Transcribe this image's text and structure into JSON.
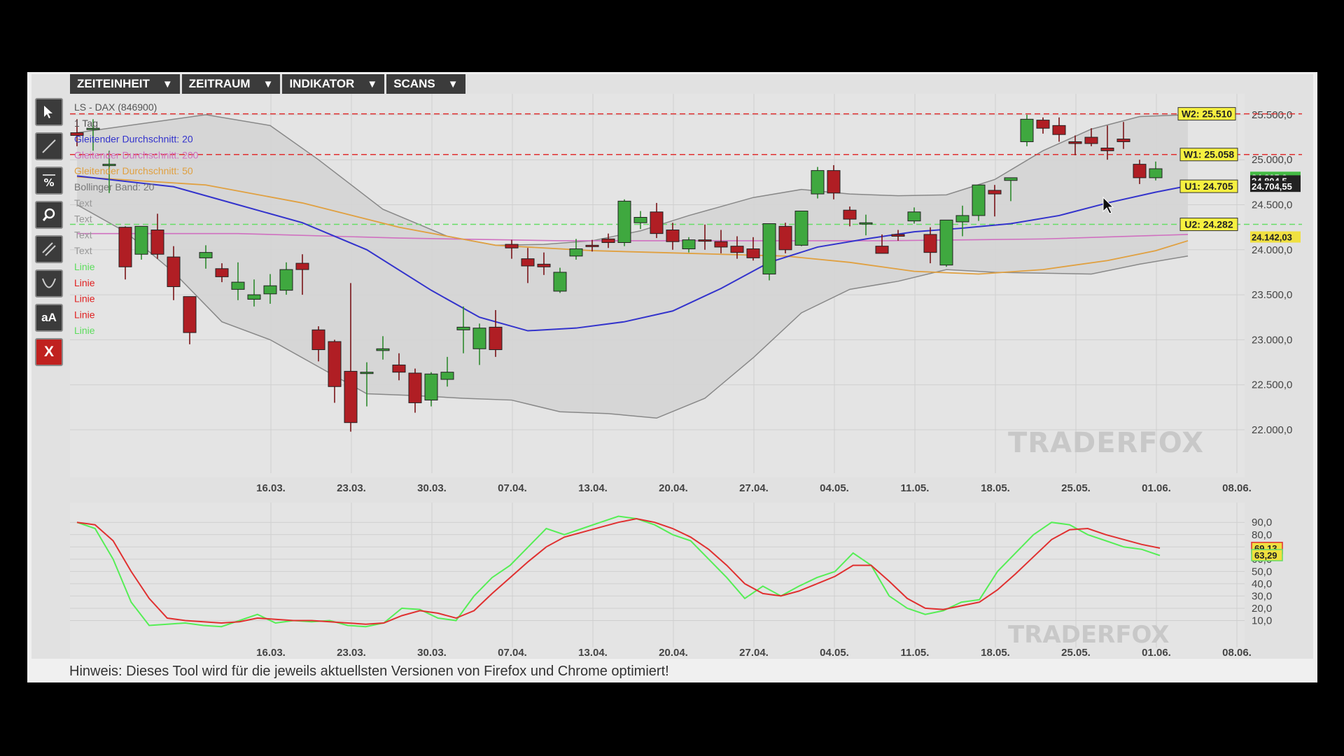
{
  "menu": [
    {
      "label": "ZEITEINHEIT"
    },
    {
      "label": "ZEITRAUM"
    },
    {
      "label": "INDIKATOR"
    },
    {
      "label": "SCANS"
    }
  ],
  "toolbar": [
    {
      "name": "select-tool",
      "icon": "cursor-icon"
    },
    {
      "name": "line-tool",
      "icon": "line-icon"
    },
    {
      "name": "percent-tool",
      "icon": "percent-icon"
    },
    {
      "name": "zoom-tool",
      "icon": "magnifier-icon"
    },
    {
      "name": "channel-tool",
      "icon": "parallel-lines-icon"
    },
    {
      "name": "arc-tool",
      "icon": "arc-icon"
    },
    {
      "name": "text-tool",
      "icon": "text-size-icon",
      "label": "aA"
    },
    {
      "name": "delete-tool",
      "icon": "close-icon",
      "label": "X"
    }
  ],
  "legend": [
    {
      "text": "LS - DAX (846900)",
      "color": "#555555"
    },
    {
      "text": "1 Tag",
      "color": "#555555"
    },
    {
      "text": "Gleitender Durchschnitt: 20",
      "color": "#3333cc"
    },
    {
      "text": "Gleitender Durchschnitt: 200",
      "color": "#d070c0"
    },
    {
      "text": "Gleitender Durchschnitt: 50",
      "color": "#e0a040"
    },
    {
      "text": "Bollinger Band: 20",
      "color": "#777777"
    },
    {
      "text": "Text",
      "color": "#999999"
    },
    {
      "text": "Text",
      "color": "#999999"
    },
    {
      "text": "Text",
      "color": "#999999"
    },
    {
      "text": "Text",
      "color": "#999999"
    },
    {
      "text": "Linie",
      "color": "#5cdd5c"
    },
    {
      "text": "Linie",
      "color": "#e02020"
    },
    {
      "text": "Linie",
      "color": "#e02020"
    },
    {
      "text": "Linie",
      "color": "#e02020"
    },
    {
      "text": "Linie",
      "color": "#5cdd5c"
    }
  ],
  "levels": [
    {
      "label": "W2: 25.510",
      "value": 25510,
      "color": "#e03030",
      "style": "dashed"
    },
    {
      "label": "W1: 25.058",
      "value": 25058,
      "color": "#e03030",
      "style": "dashed"
    },
    {
      "label": "U1: 24.705",
      "value": 24705,
      "color": "#e03030",
      "style": "none"
    },
    {
      "label": "U2: 24.282",
      "value": 24282,
      "color": "#66dd66",
      "style": "dashed"
    }
  ],
  "price_tags": [
    {
      "text": "24.805,0",
      "value": 24805,
      "bg": "#44bb44",
      "fg": "#ffffff"
    },
    {
      "text": "24.804,5",
      "value": 24765,
      "bg": "#222222",
      "fg": "#ffffff"
    },
    {
      "text": "24.704,55",
      "value": 24704.55,
      "bg": "#222222",
      "fg": "#ffffff"
    },
    {
      "text": "24.142,03",
      "value": 24142.03,
      "bg": "#f0e040",
      "fg": "#222222"
    }
  ],
  "osc_tags": [
    {
      "text": "69,13",
      "value": 69.13,
      "bg": "#f0e040",
      "fg": "#222222",
      "border": "#e03030"
    },
    {
      "text": "63,29",
      "value": 63.29,
      "bg": "#f0e040",
      "fg": "#222222",
      "border": "#66dd66"
    }
  ],
  "watermark": "TRADERFOX",
  "hint": "Hinweis: Dieses Tool wird für die jeweils aktuellsten Versionen von Firefox und Chrome optimiert!",
  "colors": {
    "up": "#3fa83f",
    "down": "#b01e24",
    "ma20": "#3333cc",
    "ma200": "#d070c0",
    "ma50": "#e0a040",
    "boll": "#888888",
    "stochK": "#55ee55",
    "stochD": "#e03030"
  },
  "chart_data": [
    {
      "type": "candlestick",
      "title": "LS - DAX (846900)",
      "x_ticks": [
        "16.03.",
        "23.03.",
        "30.03.",
        "07.04.",
        "13.04.",
        "20.04.",
        "27.04.",
        "04.05.",
        "11.05.",
        "18.05.",
        "25.05.",
        "01.06.",
        "08.06."
      ],
      "y_ticks": [
        {
          "label": "25.500,0",
          "value": 25500
        },
        {
          "label": "25.000,0",
          "value": 25000
        },
        {
          "label": "24.500,0",
          "value": 24500
        },
        {
          "label": "24.000,0",
          "value": 24000
        },
        {
          "label": "23.500,0",
          "value": 23500
        },
        {
          "label": "23.000,0",
          "value": 23000
        },
        {
          "label": "22.500,0",
          "value": 22500
        },
        {
          "label": "22.000,0",
          "value": 22000
        }
      ],
      "candles": [
        {
          "o": 25300,
          "h": 25450,
          "l": 25150,
          "c": 25270
        },
        {
          "o": 25350,
          "h": 25450,
          "l": 25100,
          "c": 25350
        },
        {
          "o": 24950,
          "h": 25100,
          "l": 24630,
          "c": 24950
        },
        {
          "o": 24250,
          "h": 24260,
          "l": 23670,
          "c": 23810
        },
        {
          "o": 23950,
          "h": 24260,
          "l": 23890,
          "c": 24260
        },
        {
          "o": 24220,
          "h": 24400,
          "l": 23900,
          "c": 23950
        },
        {
          "o": 23920,
          "h": 24040,
          "l": 23440,
          "c": 23590
        },
        {
          "o": 23480,
          "h": 23480,
          "l": 22950,
          "c": 23080
        },
        {
          "o": 23910,
          "h": 24050,
          "l": 23790,
          "c": 23970
        },
        {
          "o": 23790,
          "h": 23850,
          "l": 23640,
          "c": 23700
        },
        {
          "o": 23560,
          "h": 23860,
          "l": 23440,
          "c": 23640
        },
        {
          "o": 23450,
          "h": 23670,
          "l": 23370,
          "c": 23500
        },
        {
          "o": 23510,
          "h": 23730,
          "l": 23400,
          "c": 23600
        },
        {
          "o": 23550,
          "h": 23860,
          "l": 23500,
          "c": 23780
        },
        {
          "o": 23850,
          "h": 23950,
          "l": 23500,
          "c": 23780
        },
        {
          "o": 23110,
          "h": 23150,
          "l": 22760,
          "c": 22890
        },
        {
          "o": 22980,
          "h": 23000,
          "l": 22300,
          "c": 22480
        },
        {
          "o": 22650,
          "h": 23630,
          "l": 21980,
          "c": 22080
        },
        {
          "o": 22640,
          "h": 22750,
          "l": 22260,
          "c": 22640
        },
        {
          "o": 22880,
          "h": 23040,
          "l": 22780,
          "c": 22900
        },
        {
          "o": 22720,
          "h": 22850,
          "l": 22550,
          "c": 22640
        },
        {
          "o": 22630,
          "h": 22680,
          "l": 22190,
          "c": 22300
        },
        {
          "o": 22330,
          "h": 22640,
          "l": 22260,
          "c": 22620
        },
        {
          "o": 22560,
          "h": 22810,
          "l": 22480,
          "c": 22640
        },
        {
          "o": 23110,
          "h": 23370,
          "l": 22850,
          "c": 23140
        },
        {
          "o": 22900,
          "h": 23180,
          "l": 22720,
          "c": 23130
        },
        {
          "o": 23140,
          "h": 23330,
          "l": 22810,
          "c": 22890
        },
        {
          "o": 24060,
          "h": 24110,
          "l": 23900,
          "c": 24020
        },
        {
          "o": 23900,
          "h": 24020,
          "l": 23630,
          "c": 23820
        },
        {
          "o": 23840,
          "h": 23970,
          "l": 23720,
          "c": 23810
        },
        {
          "o": 23540,
          "h": 23800,
          "l": 23520,
          "c": 23750
        },
        {
          "o": 23930,
          "h": 24120,
          "l": 23890,
          "c": 24010
        },
        {
          "o": 24050,
          "h": 24110,
          "l": 23980,
          "c": 24040
        },
        {
          "o": 24120,
          "h": 24180,
          "l": 24020,
          "c": 24080
        },
        {
          "o": 24080,
          "h": 24560,
          "l": 24040,
          "c": 24540
        },
        {
          "o": 24300,
          "h": 24430,
          "l": 24230,
          "c": 24360
        },
        {
          "o": 24420,
          "h": 24520,
          "l": 24130,
          "c": 24180
        },
        {
          "o": 24220,
          "h": 24300,
          "l": 24000,
          "c": 24090
        },
        {
          "o": 24010,
          "h": 24140,
          "l": 23970,
          "c": 24110
        },
        {
          "o": 24110,
          "h": 24280,
          "l": 24000,
          "c": 24100
        },
        {
          "o": 24090,
          "h": 24220,
          "l": 23960,
          "c": 24030
        },
        {
          "o": 24040,
          "h": 24150,
          "l": 23900,
          "c": 23970
        },
        {
          "o": 24010,
          "h": 24140,
          "l": 23880,
          "c": 23910
        },
        {
          "o": 23730,
          "h": 24290,
          "l": 23660,
          "c": 24290
        },
        {
          "o": 24260,
          "h": 24300,
          "l": 23960,
          "c": 24000
        },
        {
          "o": 24050,
          "h": 24430,
          "l": 24040,
          "c": 24430
        },
        {
          "o": 24620,
          "h": 24920,
          "l": 24570,
          "c": 24880
        },
        {
          "o": 24880,
          "h": 24940,
          "l": 24560,
          "c": 24630
        },
        {
          "o": 24440,
          "h": 24480,
          "l": 24260,
          "c": 24340
        },
        {
          "o": 24300,
          "h": 24390,
          "l": 24160,
          "c": 24300
        },
        {
          "o": 24040,
          "h": 24170,
          "l": 23980,
          "c": 23960
        },
        {
          "o": 24170,
          "h": 24220,
          "l": 24100,
          "c": 24150
        },
        {
          "o": 24320,
          "h": 24470,
          "l": 24290,
          "c": 24420
        },
        {
          "o": 24170,
          "h": 24250,
          "l": 23850,
          "c": 23970
        },
        {
          "o": 23830,
          "h": 24330,
          "l": 23810,
          "c": 24330
        },
        {
          "o": 24310,
          "h": 24490,
          "l": 24150,
          "c": 24380
        },
        {
          "o": 24380,
          "h": 24660,
          "l": 24320,
          "c": 24720
        },
        {
          "o": 24660,
          "h": 24720,
          "l": 24370,
          "c": 24620
        },
        {
          "o": 24770,
          "h": 24800,
          "l": 24540,
          "c": 24800
        },
        {
          "o": 25200,
          "h": 25500,
          "l": 25150,
          "c": 25450
        },
        {
          "o": 25440,
          "h": 25470,
          "l": 25290,
          "c": 25350
        },
        {
          "o": 25380,
          "h": 25470,
          "l": 25200,
          "c": 25280
        },
        {
          "o": 25200,
          "h": 25270,
          "l": 25050,
          "c": 25180
        },
        {
          "o": 25250,
          "h": 25350,
          "l": 25150,
          "c": 25180
        },
        {
          "o": 25130,
          "h": 25380,
          "l": 25000,
          "c": 25100
        },
        {
          "o": 25230,
          "h": 25420,
          "l": 25120,
          "c": 25200
        },
        {
          "o": 24950,
          "h": 25000,
          "l": 24730,
          "c": 24800
        },
        {
          "o": 24800,
          "h": 24980,
          "l": 24770,
          "c": 24900
        }
      ],
      "ma20": [
        [
          0,
          24820
        ],
        [
          6,
          24700
        ],
        [
          10,
          24500
        ],
        [
          14,
          24300
        ],
        [
          18,
          24000
        ],
        [
          22,
          23550
        ],
        [
          25,
          23250
        ],
        [
          28,
          23100
        ],
        [
          31,
          23130
        ],
        [
          34,
          23200
        ],
        [
          37,
          23320
        ],
        [
          40,
          23570
        ],
        [
          43,
          23860
        ],
        [
          46,
          24030
        ],
        [
          49,
          24120
        ],
        [
          52,
          24200
        ],
        [
          55,
          24240
        ],
        [
          58,
          24290
        ],
        [
          61,
          24380
        ],
        [
          64,
          24520
        ],
        [
          67,
          24640
        ],
        [
          69,
          24710
        ]
      ],
      "ma200": [
        [
          0,
          24180
        ],
        [
          10,
          24180
        ],
        [
          20,
          24130
        ],
        [
          30,
          24100
        ],
        [
          40,
          24100
        ],
        [
          50,
          24100
        ],
        [
          60,
          24120
        ],
        [
          69,
          24170
        ]
      ],
      "ma50": [
        [
          0,
          24810
        ],
        [
          8,
          24720
        ],
        [
          14,
          24520
        ],
        [
          20,
          24250
        ],
        [
          26,
          24050
        ],
        [
          32,
          23990
        ],
        [
          38,
          23960
        ],
        [
          44,
          23930
        ],
        [
          48,
          23860
        ],
        [
          52,
          23760
        ],
        [
          56,
          23730
        ],
        [
          60,
          23780
        ],
        [
          64,
          23880
        ],
        [
          67,
          23990
        ],
        [
          69,
          24100
        ]
      ],
      "boll_upper": [
        [
          0,
          25300
        ],
        [
          4,
          25400
        ],
        [
          8,
          25500
        ],
        [
          12,
          25380
        ],
        [
          15,
          25000
        ],
        [
          19,
          24450
        ],
        [
          23,
          24150
        ],
        [
          26,
          24050
        ],
        [
          29,
          24060
        ],
        [
          32,
          24100
        ],
        [
          35,
          24210
        ],
        [
          38,
          24380
        ],
        [
          42,
          24580
        ],
        [
          45,
          24670
        ],
        [
          48,
          24620
        ],
        [
          51,
          24600
        ],
        [
          54,
          24610
        ],
        [
          57,
          24780
        ],
        [
          60,
          25100
        ],
        [
          63,
          25340
        ],
        [
          66,
          25480
        ],
        [
          69,
          25500
        ]
      ],
      "boll_lower": [
        [
          0,
          24500
        ],
        [
          3,
          24200
        ],
        [
          6,
          23750
        ],
        [
          9,
          23200
        ],
        [
          12,
          23000
        ],
        [
          15,
          22700
        ],
        [
          18,
          22400
        ],
        [
          21,
          22380
        ],
        [
          24,
          22350
        ],
        [
          27,
          22330
        ],
        [
          30,
          22200
        ],
        [
          33,
          22180
        ],
        [
          36,
          22130
        ],
        [
          39,
          22350
        ],
        [
          42,
          22800
        ],
        [
          45,
          23300
        ],
        [
          48,
          23560
        ],
        [
          51,
          23650
        ],
        [
          54,
          23780
        ],
        [
          57,
          23750
        ],
        [
          60,
          23740
        ],
        [
          63,
          23730
        ],
        [
          66,
          23840
        ],
        [
          69,
          23930
        ]
      ]
    },
    {
      "type": "line",
      "title": "",
      "x_ticks": [
        "16.03.",
        "23.03.",
        "30.03.",
        "07.04.",
        "13.04.",
        "20.04.",
        "27.04.",
        "04.05.",
        "11.05.",
        "18.05.",
        "25.05.",
        "01.06.",
        "08.06."
      ],
      "y_ticks": [
        {
          "label": "90,0",
          "value": 90
        },
        {
          "label": "80,0",
          "value": 80
        },
        {
          "label": "70,0",
          "value": 70
        },
        {
          "label": "60,0",
          "value": 60
        },
        {
          "label": "50,0",
          "value": 50
        },
        {
          "label": "40,0",
          "value": 40
        },
        {
          "label": "30,0",
          "value": 30
        },
        {
          "label": "20,0",
          "value": 20
        },
        {
          "label": "10,0",
          "value": 10
        }
      ],
      "ylim": [
        0,
        90
      ],
      "series": [
        {
          "name": "",
          "key": "stochK",
          "values": [
            90,
            85,
            60,
            25,
            6,
            7,
            8,
            6,
            5,
            10,
            15,
            8,
            10,
            9,
            10,
            6,
            5,
            8,
            20,
            19,
            12,
            10,
            30,
            45,
            55,
            70,
            85,
            80,
            85,
            90,
            95,
            93,
            88,
            80,
            75,
            60,
            45,
            28,
            38,
            30,
            38,
            45,
            50,
            65,
            55,
            30,
            20,
            15,
            18,
            25,
            27,
            50,
            65,
            80,
            90,
            88,
            80,
            75,
            70,
            68,
            63
          ]
        },
        {
          "name": "",
          "key": "stochD",
          "values": [
            90,
            88,
            75,
            50,
            28,
            12,
            10,
            9,
            8,
            9,
            12,
            11,
            10,
            10,
            9,
            8,
            7,
            8,
            14,
            18,
            16,
            12,
            18,
            32,
            45,
            58,
            70,
            78,
            82,
            86,
            90,
            93,
            90,
            85,
            78,
            68,
            55,
            40,
            32,
            30,
            34,
            40,
            46,
            55,
            55,
            42,
            28,
            20,
            19,
            22,
            25,
            35,
            48,
            62,
            76,
            84,
            85,
            80,
            76,
            72,
            69
          ]
        }
      ]
    }
  ]
}
